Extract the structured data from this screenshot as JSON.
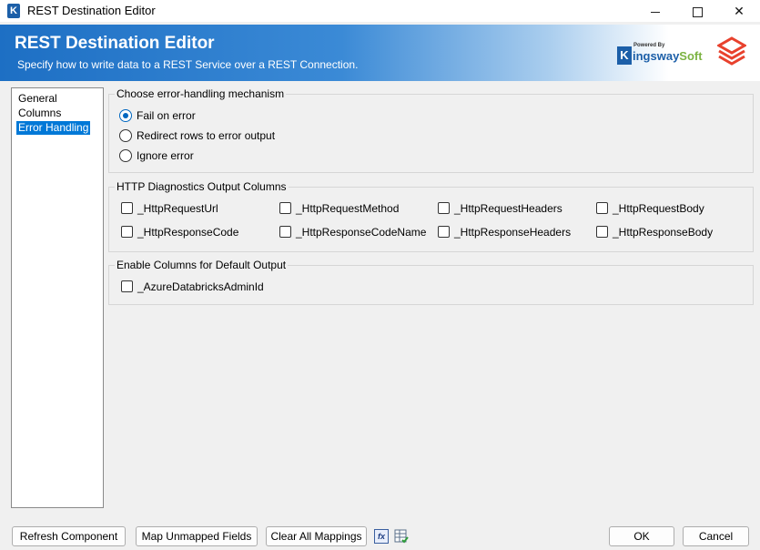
{
  "window": {
    "title": "REST Destination Editor",
    "app_icon": "K"
  },
  "banner": {
    "title": "REST Destination Editor",
    "subtitle": "Specify how to write data to a REST Service over a REST Connection.",
    "logo_powered": "Powered By",
    "logo_k": "K",
    "logo_name_a": "ingsway",
    "logo_name_b": "Soft",
    "colors": {
      "start": "#1d6fc4",
      "end": "#ffffff",
      "databricks": "#e8412d"
    }
  },
  "nav": {
    "items": [
      "General",
      "Columns",
      "Error Handling"
    ],
    "selected_index": 2
  },
  "error_handling": {
    "legend": "Choose error-handling mechanism",
    "options": [
      "Fail on error",
      "Redirect rows to error output",
      "Ignore error"
    ],
    "selected": "Fail on error"
  },
  "http_diagnostics": {
    "legend": "HTTP Diagnostics Output Columns",
    "columns": [
      "_HttpRequestUrl",
      "_HttpRequestMethod",
      "_HttpRequestHeaders",
      "_HttpRequestBody",
      "_HttpResponseCode",
      "_HttpResponseCodeName",
      "_HttpResponseHeaders",
      "_HttpResponseBody"
    ]
  },
  "default_output": {
    "legend": "Enable Columns for Default Output",
    "columns": [
      "_AzureDatabricksAdminId"
    ]
  },
  "buttons": {
    "refresh": "Refresh Component",
    "map_unmapped": "Map Unmapped Fields",
    "clear_mappings": "Clear All Mappings",
    "fx_icon": "fx",
    "ok": "OK",
    "cancel": "Cancel"
  }
}
